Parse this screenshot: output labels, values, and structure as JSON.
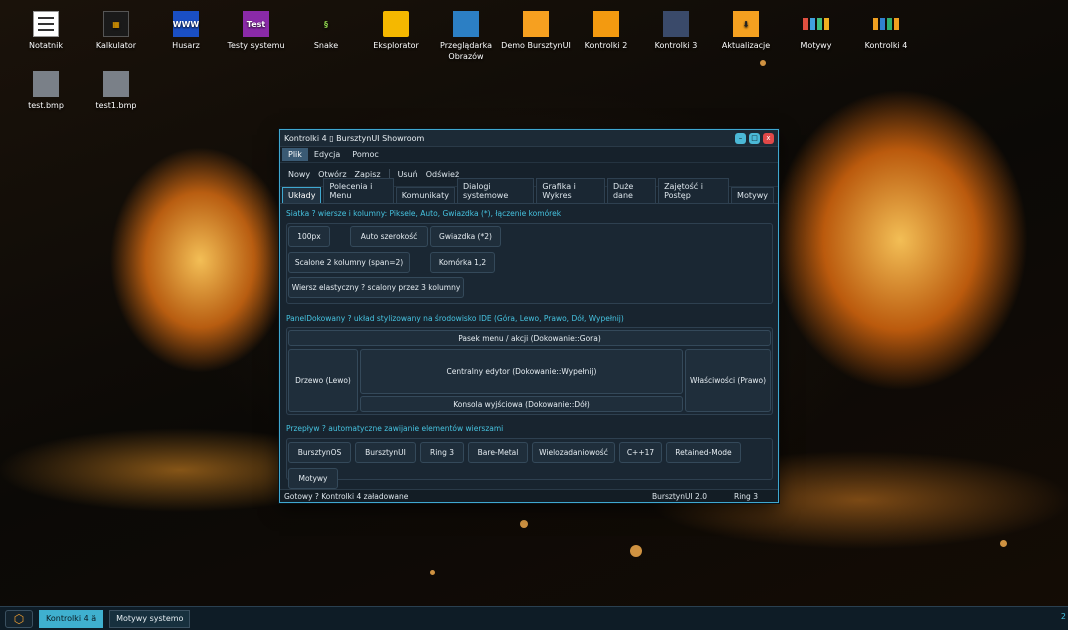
{
  "desktop": {
    "icons": [
      {
        "label": "Notatnik",
        "icon": "notepad-icon"
      },
      {
        "label": "Kalkulator",
        "icon": "calculator-icon"
      },
      {
        "label": "Husarz",
        "icon": "web-browser-icon",
        "glyph": "WWW"
      },
      {
        "label": "Testy systemu",
        "icon": "test-icon",
        "glyph": "Test"
      },
      {
        "label": "Snake",
        "icon": "snake-icon"
      },
      {
        "label": "Eksplorator",
        "icon": "folder-icon"
      },
      {
        "label": "Przeglądarka Obrazów",
        "icon": "image-viewer-icon"
      },
      {
        "label": "Demo BursztynUI",
        "icon": "demo-icon"
      },
      {
        "label": "Kontrolki 2",
        "icon": "controls-icon"
      },
      {
        "label": "Kontrolki 3",
        "icon": "sliders-icon"
      },
      {
        "label": "Aktualizacje",
        "icon": "download-icon"
      },
      {
        "label": "Motywy",
        "icon": "themes-icon"
      },
      {
        "label": "Kontrolki 4",
        "icon": "tiles-icon"
      },
      {
        "label": "test.bmp",
        "icon": "bitmap-file-icon"
      },
      {
        "label": "test1.bmp",
        "icon": "bitmap-file-icon"
      }
    ]
  },
  "window": {
    "title": "Kontrolki 4 ▯ BursztynUI Showroom",
    "menu": [
      "Plik",
      "Edycja",
      "Pomoc"
    ],
    "toolbar": [
      "Nowy",
      "Otwórz",
      "Zapisz",
      "Usuń",
      "Odśwież"
    ],
    "tabs": [
      "Układy",
      "Polecenia i Menu",
      "Komunikaty",
      "Dialogi systemowe",
      "Grafika i Wykres",
      "Duże dane",
      "Zajętość i Postęp",
      "Motywy"
    ],
    "grid_section": {
      "title": "Siatka ? wiersze i kolumny: Piksele, Auto, Gwiazdka (*), łączenie komórek",
      "buttons": [
        "100px",
        "Auto szerokość",
        "Gwiazdka (*2)",
        "Scalone 2 kolumny (span=2)",
        "Komórka 1,2",
        "Wiersz elastyczny ? scalony przez 3 kolumny"
      ]
    },
    "dock_section": {
      "title": "PanelDokowany ? układ stylizowany na środowisko IDE (Góra, Lewo, Prawo, Dół, Wypełnij)",
      "top": "Pasek menu / akcji (Dokowanie::Gora)",
      "left": "Drzewo (Lewo)",
      "center": "Centralny edytor (Dokowanie::Wypełnij)",
      "right": "Właściwości (Prawo)",
      "bottom": "Konsola wyjściowa (Dokowanie::Dół)"
    },
    "flow_section": {
      "title": "Przepływ ? automatyczne zawijanie elementów wierszami",
      "buttons": [
        "BursztynOS",
        "BursztynUI",
        "Ring 3",
        "Bare-Metal",
        "Wielozadaniowość",
        "C++17",
        "Retained-Mode",
        "Motywy"
      ]
    },
    "status": {
      "main": "Gotowy ? Kontrolki 4 załadowane",
      "version": "BursztynUI 2.0",
      "ring": "Ring 3"
    }
  },
  "taskbar": {
    "tasks": [
      "Kontrolki 4 ä",
      "Motywy systemo"
    ],
    "tray": "2"
  },
  "colors": {
    "accent": "#3fa8d0",
    "section_title": "#46c3e0",
    "close": "#e04848"
  }
}
